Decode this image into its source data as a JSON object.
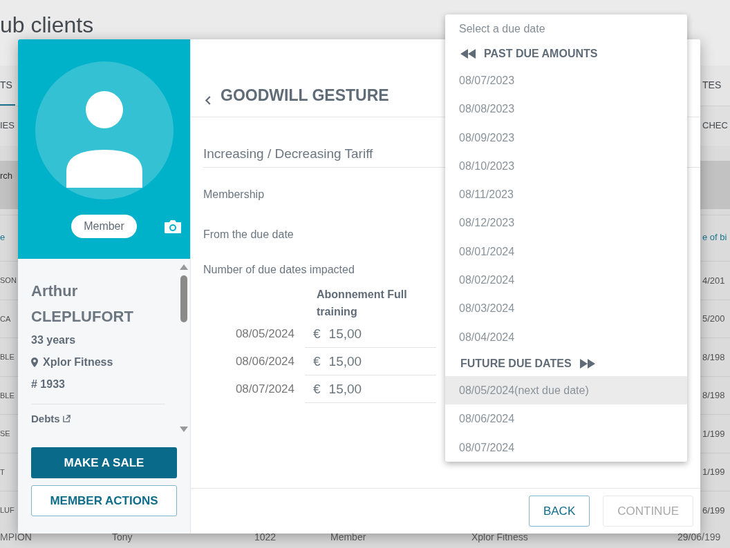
{
  "background": {
    "page_title": "ub clients",
    "tabs": [
      {
        "label": "TS",
        "selected": true
      },
      {
        "label": "TES",
        "selected": false
      }
    ],
    "subtabs": [
      "IES",
      "CHEC"
    ],
    "search_placeholder": "rch",
    "columns": [
      "e",
      "e of bi"
    ],
    "rows": [
      {
        "column_1": "SON",
        "column_2": "4/201"
      },
      {
        "column_1": "CA",
        "column_2": "5/200"
      },
      {
        "column_1": "BLE",
        "column_2": "8/198"
      },
      {
        "column_1": "BLE",
        "column_2": "8/198"
      },
      {
        "column_1": "SE",
        "column_2": "1/199"
      },
      {
        "column_1": "T",
        "column_2": "1/199"
      },
      {
        "column_1": "LUF",
        "column_2": "6/199"
      }
    ],
    "last_row": [
      "MPION",
      "Tony",
      "1022",
      "Member",
      "Xplor Fitness",
      "29/06/199"
    ]
  },
  "profile": {
    "badge": "Member",
    "first_name": "Arthur",
    "last_name": "CLEPLUFORT",
    "age": "33 years",
    "club": "Xplor Fitness",
    "number": "# 1933",
    "debts": "Debts"
  },
  "profile_buttons": [
    {
      "label": "MAKE A SALE",
      "kind": "primary"
    },
    {
      "label": "MEMBER ACTIONS",
      "kind": "outline"
    }
  ],
  "form": {
    "title": "GOODWILL GESTURE",
    "type_value": "Increasing / Decreasing Tariff",
    "labels": [
      "Membership",
      "From the due date",
      "Number of due dates impacted"
    ],
    "table_header": "Abonnement Full training",
    "rows": [
      {
        "date": "08/05/2024",
        "currency": "€",
        "amount": "15,00"
      },
      {
        "date": "08/06/2024",
        "currency": "€",
        "amount": "15,00"
      },
      {
        "date": "08/07/2024",
        "currency": "€",
        "amount": "15,00"
      }
    ]
  },
  "footer_buttons": [
    {
      "label": "BACK",
      "disabled": false
    },
    {
      "label": "CONTINUE",
      "disabled": true
    }
  ],
  "dropdown": {
    "placeholder": "Select a due date",
    "items": [
      {
        "kind": "rewind",
        "label": "PAST DUE AMOUNTS"
      },
      {
        "kind": "option",
        "label": "08/07/2023",
        "selected": false
      },
      {
        "kind": "option",
        "label": "08/08/2023",
        "selected": false
      },
      {
        "kind": "option",
        "label": "08/09/2023",
        "selected": false
      },
      {
        "kind": "option",
        "label": "08/10/2023",
        "selected": false
      },
      {
        "kind": "option",
        "label": "08/11/2023",
        "selected": false
      },
      {
        "kind": "option",
        "label": "08/12/2023",
        "selected": false
      },
      {
        "kind": "option",
        "label": "08/01/2024",
        "selected": false
      },
      {
        "kind": "option",
        "label": "08/02/2024",
        "selected": false
      },
      {
        "kind": "option",
        "label": "08/03/2024",
        "selected": false
      },
      {
        "kind": "option",
        "label": "08/04/2024",
        "selected": false
      },
      {
        "kind": "forward",
        "label": "FUTURE DUE DATES"
      },
      {
        "kind": "option",
        "label": "08/05/2024",
        "note": "(next due date)",
        "selected": true
      },
      {
        "kind": "option",
        "label": "08/06/2024",
        "selected": false
      },
      {
        "kind": "option",
        "label": "08/07/2024",
        "selected": false
      }
    ]
  }
}
